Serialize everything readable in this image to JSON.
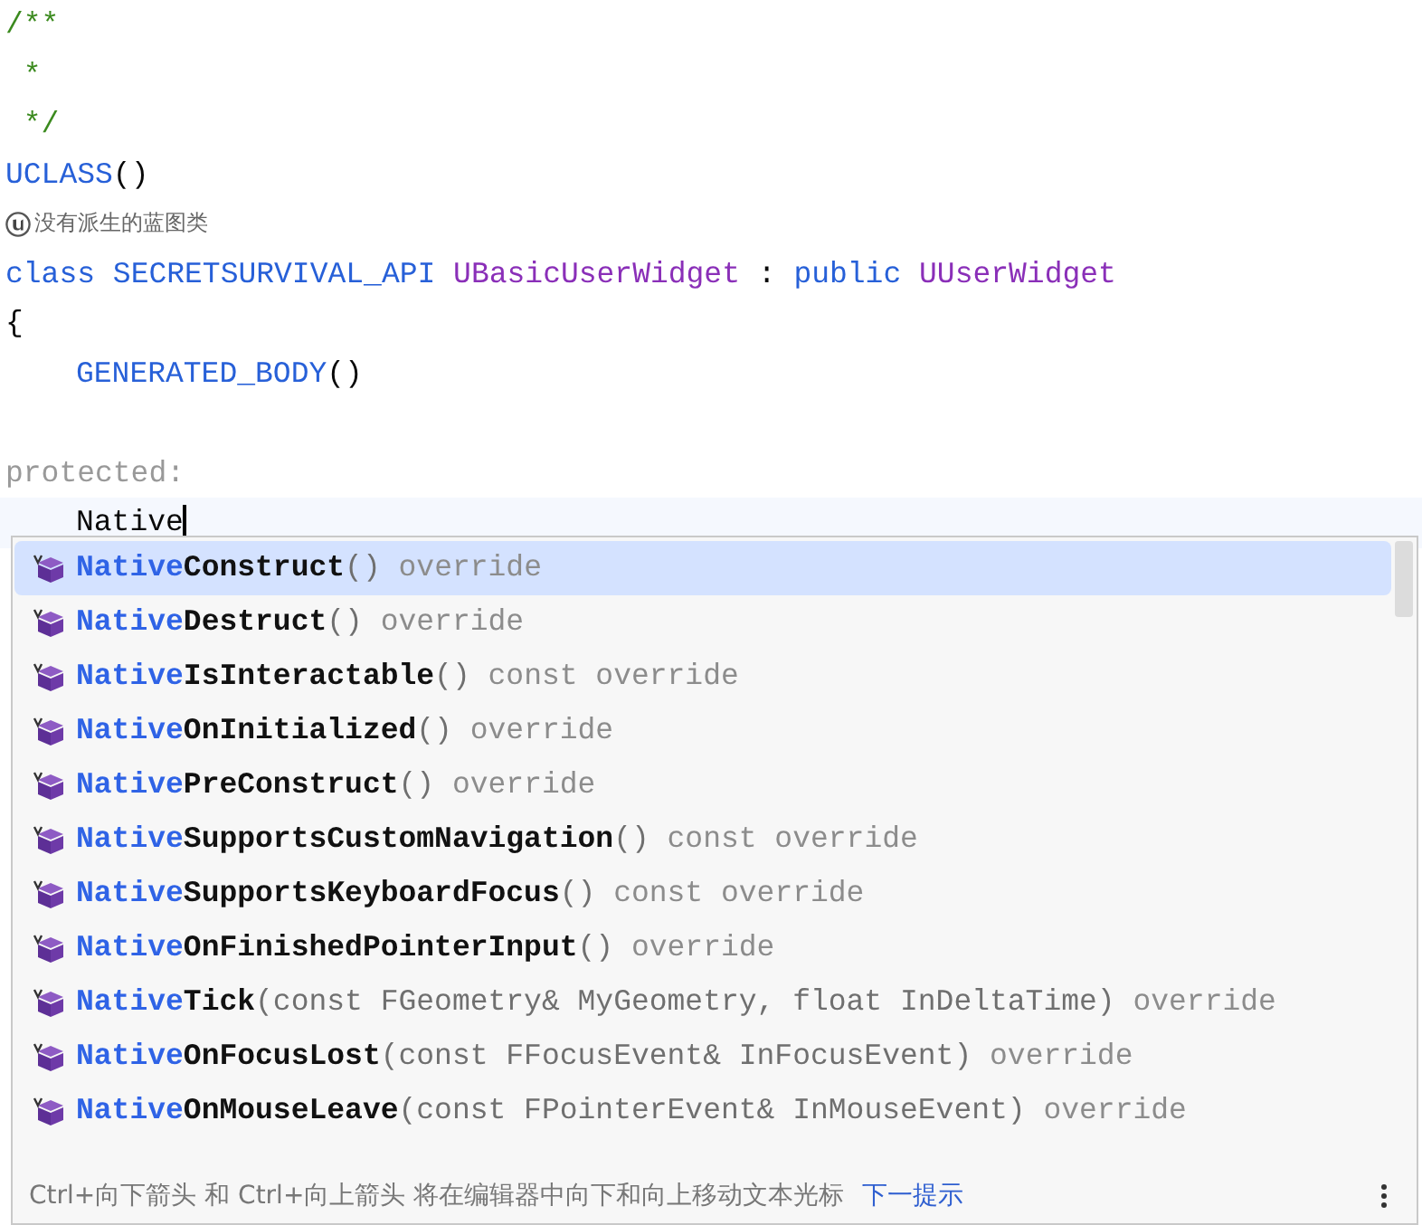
{
  "code_lines": [
    {
      "segments": [
        {
          "text": "/**",
          "kind": "comment"
        }
      ]
    },
    {
      "segments": [
        {
          "text": " *",
          "kind": "comment"
        }
      ]
    },
    {
      "segments": [
        {
          "text": " */",
          "kind": "comment"
        }
      ]
    },
    {
      "segments": [
        {
          "text": "UCLASS",
          "kind": "macro"
        },
        {
          "text": "()",
          "kind": "plain"
        }
      ]
    },
    {
      "kind": "hint",
      "segments": [
        {
          "text": "没有派生的蓝图类",
          "kind": "hint"
        }
      ]
    },
    {
      "segments": [
        {
          "text": "class",
          "kind": "keyword"
        },
        {
          "text": " SECRETSURVIVAL_API",
          "kind": "macro"
        },
        {
          "text": " UBasicUserWidget",
          "kind": "type"
        },
        {
          "text": " :",
          "kind": "plain"
        },
        {
          "text": " public",
          "kind": "keyword"
        },
        {
          "text": " UUserWidget",
          "kind": "type"
        }
      ]
    },
    {
      "segments": [
        {
          "text": "{",
          "kind": "plain"
        }
      ]
    },
    {
      "indented": true,
      "segments": [
        {
          "text": "GENERATED_BODY",
          "kind": "macro"
        },
        {
          "text": "()",
          "kind": "plain"
        }
      ]
    },
    {
      "spaced": true,
      "segments": [
        {
          "text": "protected:",
          "kind": "modifier"
        }
      ]
    },
    {
      "current": true,
      "indented": true,
      "segments": [
        {
          "text": "Native",
          "kind": "plain"
        }
      ]
    }
  ],
  "completions": [
    {
      "prefix": "Native",
      "name": "Construct",
      "signature": "()",
      "qualifiers": "override",
      "selected": true
    },
    {
      "prefix": "Native",
      "name": "Destruct",
      "signature": "()",
      "qualifiers": "override",
      "selected": false
    },
    {
      "prefix": "Native",
      "name": "IsInteractable",
      "signature": "()",
      "qualifiers": "const override",
      "selected": false
    },
    {
      "prefix": "Native",
      "name": "OnInitialized",
      "signature": "()",
      "qualifiers": "override",
      "selected": false
    },
    {
      "prefix": "Native",
      "name": "PreConstruct",
      "signature": "()",
      "qualifiers": "override",
      "selected": false
    },
    {
      "prefix": "Native",
      "name": "SupportsCustomNavigation",
      "signature": "()",
      "qualifiers": "const override",
      "selected": false
    },
    {
      "prefix": "Native",
      "name": "SupportsKeyboardFocus",
      "signature": "()",
      "qualifiers": "const override",
      "selected": false
    },
    {
      "prefix": "Native",
      "name": "OnFinishedPointerInput",
      "signature": "()",
      "qualifiers": "override",
      "selected": false
    },
    {
      "prefix": "Native",
      "name": "Tick",
      "signature": "(const FGeometry& MyGeometry, float InDeltaTime)",
      "qualifiers": "override",
      "selected": false
    },
    {
      "prefix": "Native",
      "name": "OnFocusLost",
      "signature": "(const FFocusEvent& InFocusEvent)",
      "qualifiers": "override",
      "selected": false
    },
    {
      "prefix": "Native",
      "name": "OnMouseLeave",
      "signature": "(const FPointerEvent& InMouseEvent)",
      "qualifiers": "override",
      "selected": false
    }
  ],
  "footer": {
    "hint": "Ctrl+向下箭头 和 Ctrl+向上箭头 将在编辑器中向下和向上移动文本光标",
    "link": "下一提示"
  }
}
